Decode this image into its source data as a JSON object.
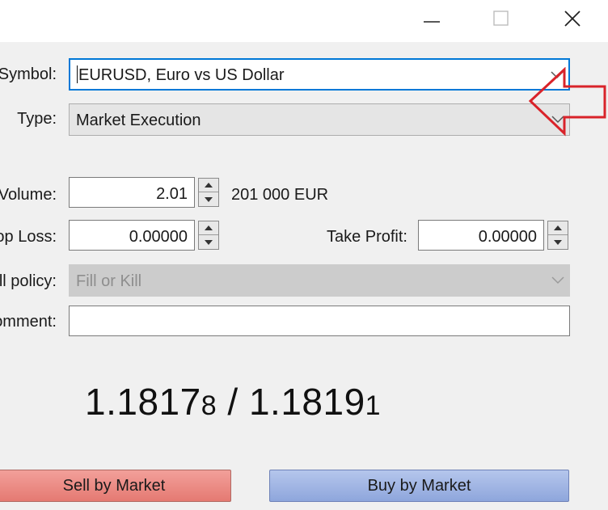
{
  "window": {
    "minimize_icon": "minimize-icon",
    "maximize_icon": "maximize-icon",
    "close_icon": "close-icon"
  },
  "form": {
    "symbol_label": "Symbol:",
    "symbol_value": "EURUSD, Euro vs US Dollar",
    "type_label": "Type:",
    "type_value": "Market Execution",
    "volume_label": "Volume:",
    "volume_value": "2.01",
    "volume_hint": "201 000 EUR",
    "stop_loss_label": "op Loss:",
    "stop_loss_value": "0.00000",
    "take_profit_label": "Take Profit:",
    "take_profit_value": "0.00000",
    "fill_policy_label": "ll policy:",
    "fill_policy_value": "Fill or Kill",
    "comment_label": "omment:",
    "comment_value": ""
  },
  "quote": {
    "bid_main": "1.1817",
    "bid_small": "8",
    "separator": " / ",
    "ask_main": "1.1819",
    "ask_small": "1"
  },
  "buttons": {
    "sell_label": "Sell by Market",
    "buy_label": "Buy by Market"
  },
  "colors": {
    "annotation_arrow": "#d9232a",
    "sell_button": "#e88a82",
    "buy_button": "#9fb4e3",
    "focus_border": "#0078d7"
  }
}
